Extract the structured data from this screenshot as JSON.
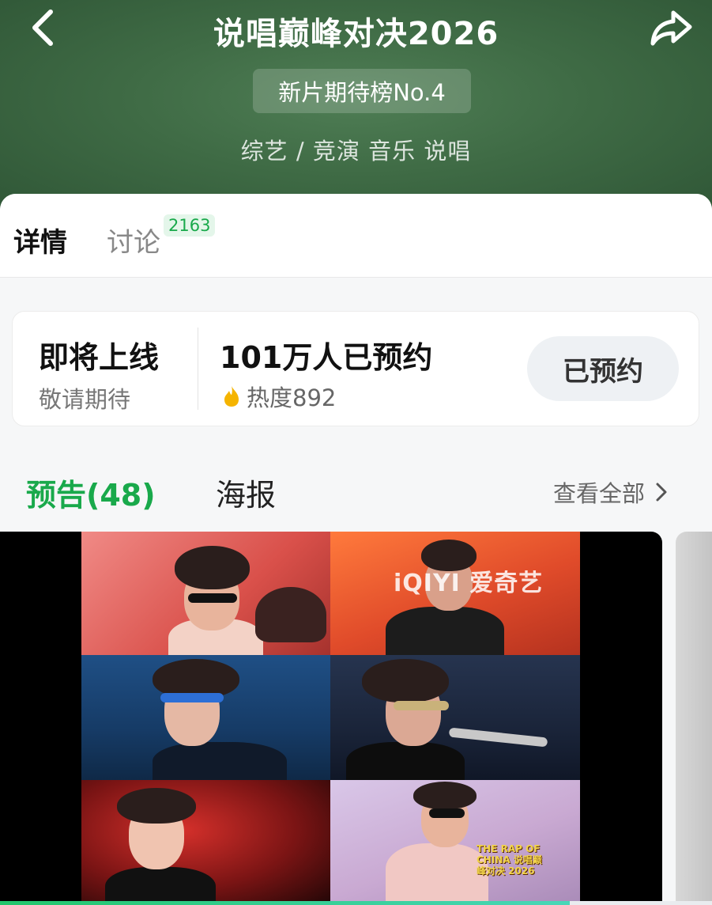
{
  "header": {
    "title": "说唱巅峰对决2026",
    "rank_badge": "新片期待榜No.4",
    "genre": "综艺 / 竞演 音乐 说唱"
  },
  "tabs": {
    "detail": "详情",
    "discuss": "讨论",
    "discuss_count": "2163"
  },
  "reserve_card": {
    "status_title": "即将上线",
    "status_sub": "敬请期待",
    "reserved_count": "101万人已预约",
    "heat": "热度892",
    "button": "已预约"
  },
  "sections": {
    "trailer": "预告(48)",
    "poster": "海报",
    "see_all": "查看全部"
  },
  "video": {
    "watermark": "iQIYI 爱奇艺",
    "logo_text": "THE RAP OF CHINA 说唱巅峰对决 2026"
  },
  "playback": {
    "progress_fraction": 0.8
  },
  "colors": {
    "accent": "#19a94b",
    "header_bg": "#3f6b45"
  }
}
